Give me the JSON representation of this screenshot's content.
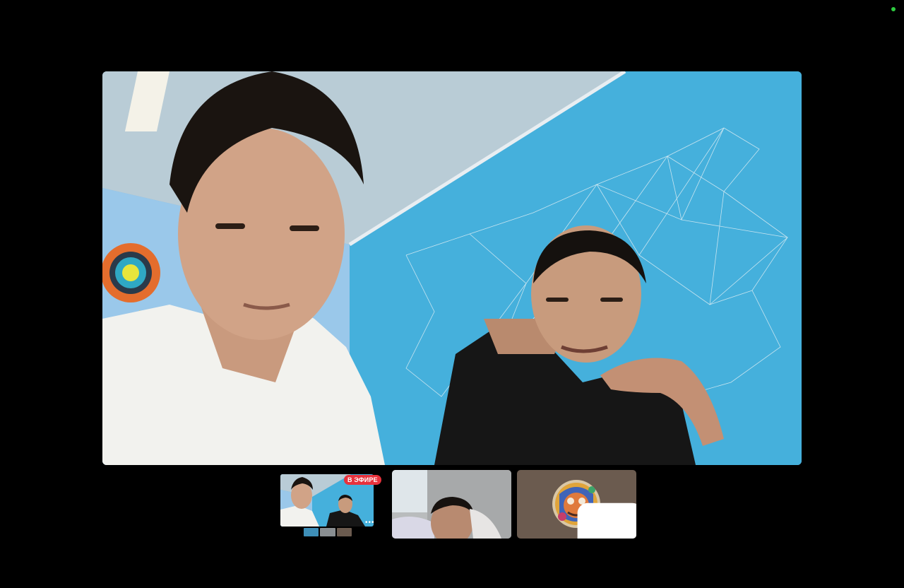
{
  "colors": {
    "background": "#000000",
    "status_dot": "#2ecc40",
    "live_badge": "#e8323c",
    "off_tile": "#6b5b4f",
    "wall_blue": "#4fb3d9"
  },
  "participants": {
    "self": {
      "live_badge": "В ЭФИРЕ",
      "more_icon": "ellipsis-icon"
    },
    "participant_2": {
      "camera": "on"
    },
    "participant_3": {
      "camera": "off",
      "icon": "video-camera-icon"
    }
  }
}
